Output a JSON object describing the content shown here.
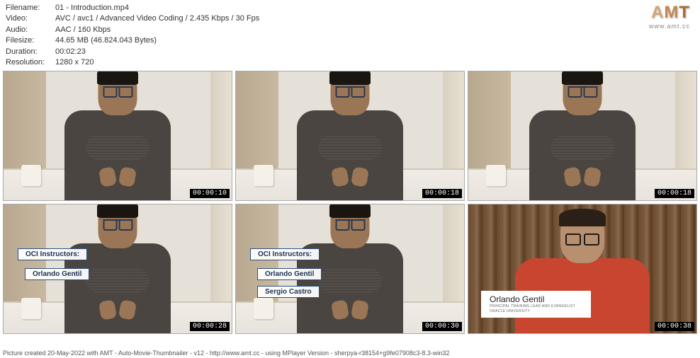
{
  "metadata": {
    "filename_label": "Filename:",
    "filename_value": "01 - Introduction.mp4",
    "video_label": "Video:",
    "video_value": "AVC / avc1 / Advanced Video Coding / 2.435 Kbps / 30 Fps",
    "audio_label": "Audio:",
    "audio_value": "AAC / 160 Kbps",
    "filesize_label": "Filesize:",
    "filesize_value": "44.65 MB (46.824.043 Bytes)",
    "duration_label": "Duration:",
    "duration_value": "00:02:23",
    "resolution_label": "Resolution:",
    "resolution_value": "1280 x 720"
  },
  "logo": {
    "a": "A",
    "m": "M",
    "t": "T",
    "url": "www.amt.cc"
  },
  "thumbnails": [
    {
      "timestamp": "00:00:10"
    },
    {
      "timestamp": "00:00:18"
    },
    {
      "timestamp": "00:00:18"
    },
    {
      "timestamp": "00:00:28",
      "overlay_title": "OCI Instructors:",
      "overlay_name1": "Orlando Gentil"
    },
    {
      "timestamp": "00:00:30",
      "overlay_title": "OCI Instructors:",
      "overlay_name1": "Orlando Gentil",
      "overlay_name2": "Sergio Castro"
    },
    {
      "timestamp": "00:00:38",
      "card_name": "Orlando Gentil",
      "card_title1": "PRINCIPAL TRAINING LEAD AND EVANGELIST",
      "card_title2": "ORACLE UNIVERSITY"
    }
  ],
  "footer": "Picture created 20-May-2022 with AMT - Auto-Movie-Thumbnailer - v12 - http://www.amt.cc - using MPlayer Version - sherpya-r38154+g9fe07908c3-8.3-win32"
}
